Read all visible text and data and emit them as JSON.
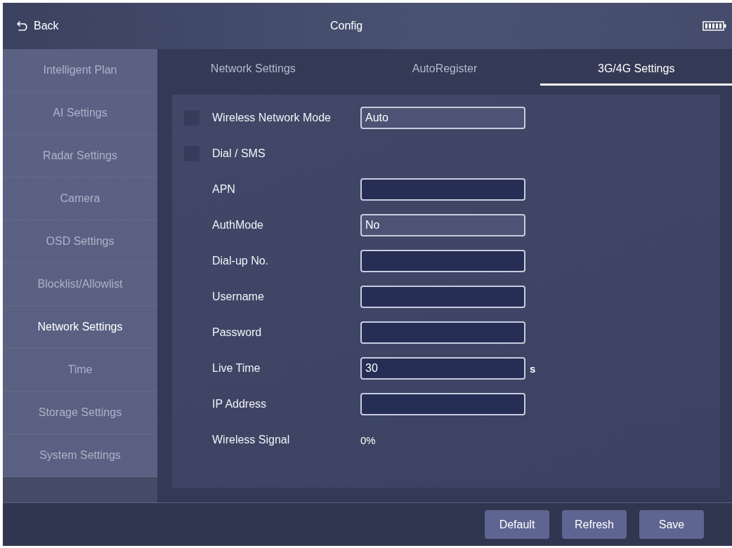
{
  "header": {
    "back_label": "Back",
    "title": "Config"
  },
  "sidebar": {
    "items": [
      {
        "label": "Intelligent Plan",
        "selected": false
      },
      {
        "label": "AI Settings",
        "selected": false
      },
      {
        "label": "Radar Settings",
        "selected": false
      },
      {
        "label": "Camera",
        "selected": false
      },
      {
        "label": "OSD Settings",
        "selected": false
      },
      {
        "label": "Blocklist/Allowlist",
        "selected": false
      },
      {
        "label": "Network Settings",
        "selected": true
      },
      {
        "label": "Time",
        "selected": false
      },
      {
        "label": "Storage Settings",
        "selected": false
      },
      {
        "label": "System Settings",
        "selected": false
      }
    ]
  },
  "tabs": [
    {
      "label": "Network Settings",
      "selected": false
    },
    {
      "label": "AutoRegister",
      "selected": false
    },
    {
      "label": "3G/4G Settings",
      "selected": true
    }
  ],
  "form": {
    "rows": [
      {
        "label": "Wireless Network Mode",
        "checked": false,
        "control": {
          "kind": "select",
          "value": "Auto"
        }
      },
      {
        "label": "Dial / SMS",
        "checked": false
      },
      {
        "label": "APN",
        "control": {
          "kind": "input"
        }
      },
      {
        "label": "AuthMode",
        "control": {
          "kind": "select",
          "value": "No"
        }
      },
      {
        "label": "Dial-up No.",
        "control": {
          "kind": "input"
        }
      },
      {
        "label": "Username",
        "control": {
          "kind": "input"
        }
      },
      {
        "label": "Password",
        "control": {
          "kind": "input"
        }
      },
      {
        "label": "Live Time",
        "control": {
          "kind": "input",
          "value": "30",
          "unit": "s"
        }
      },
      {
        "label": "IP Address",
        "control": {
          "kind": "input"
        }
      },
      {
        "label": "Wireless Signal",
        "control": {
          "kind": "readout",
          "value": "0%"
        }
      }
    ]
  },
  "buttons": [
    "Default",
    "Refresh",
    "Save"
  ]
}
